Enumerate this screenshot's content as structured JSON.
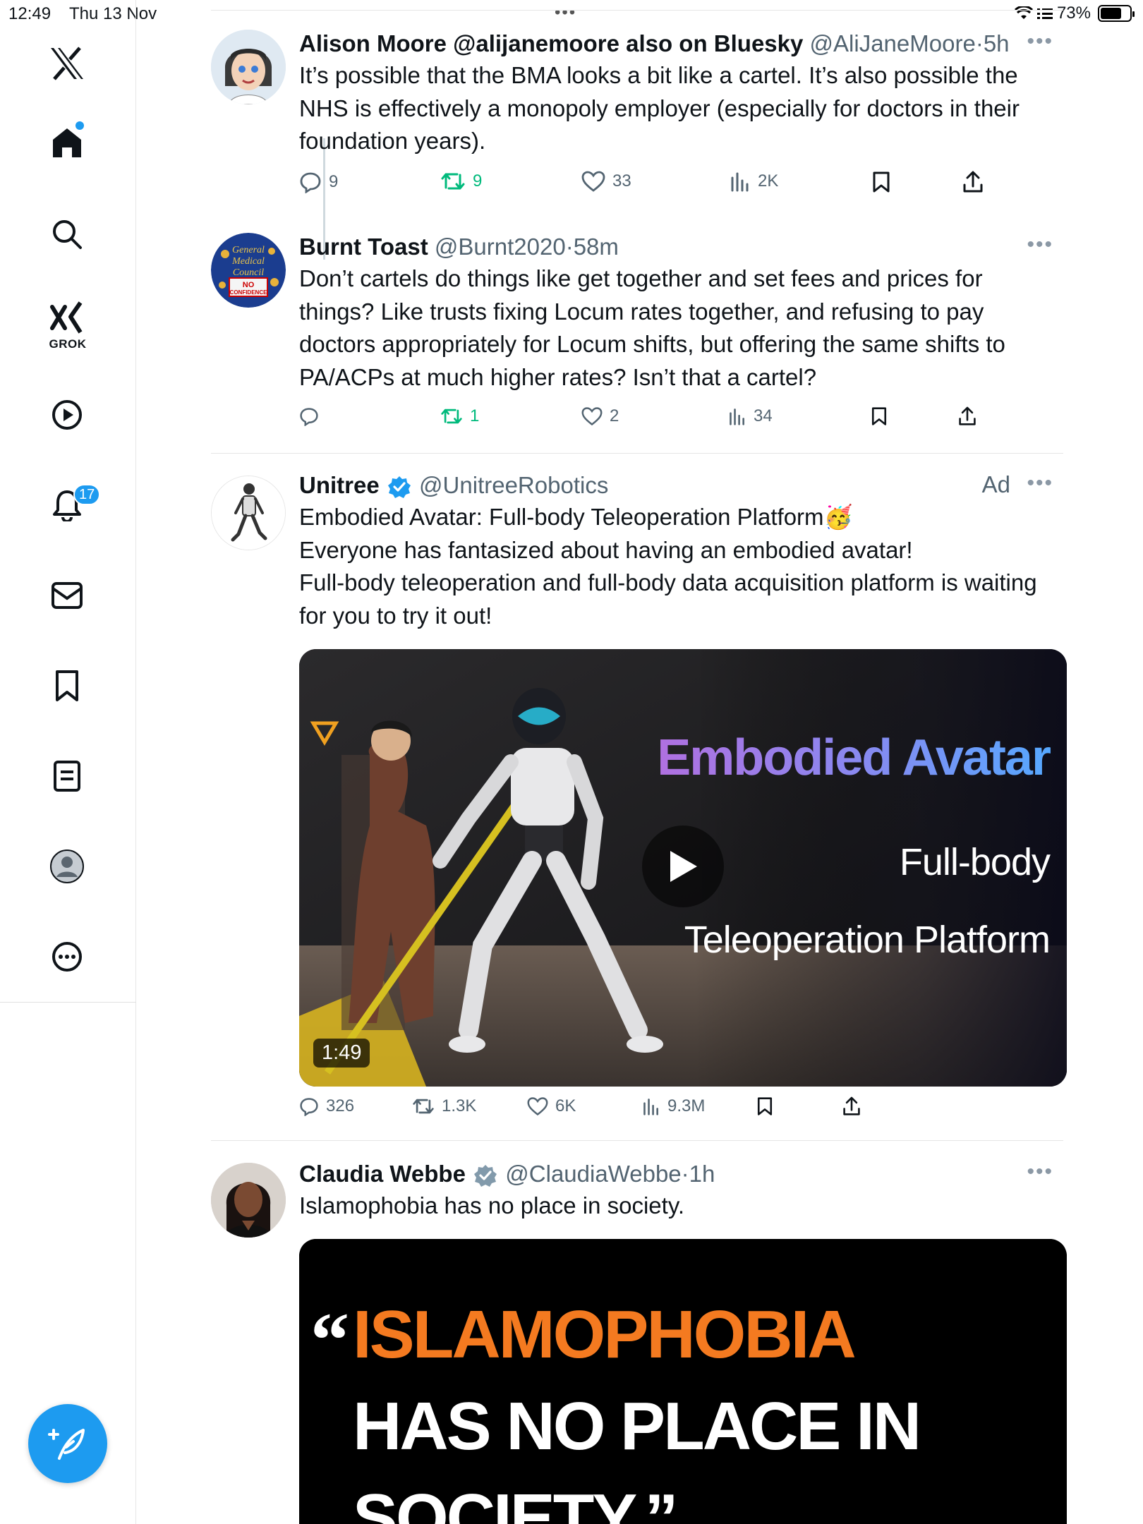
{
  "status": {
    "time": "12:49",
    "date": "Thu 13 Nov",
    "battery": "73%",
    "battery_level": 0.73,
    "dots": "•••"
  },
  "sidebar": {
    "grok_label": "GROK",
    "notifications_count": "17",
    "items": [
      "x-logo",
      "home",
      "search",
      "grok",
      "video",
      "notifications",
      "messages",
      "bookmarks",
      "lists",
      "profile",
      "more"
    ]
  },
  "tweets": [
    {
      "name": "Alison Moore @alijanemoore also on Bluesky",
      "handle": "@AliJaneMoore",
      "sep": "·",
      "time": "5h",
      "text": "It’s possible that the BMA looks a bit like a cartel. It’s also possible the NHS is effectively a monopoly employer (especially for doctors in their foundation years).",
      "replies": "9",
      "reposts": "9",
      "likes": "33",
      "views": "2K"
    },
    {
      "name": "Burnt Toast",
      "handle": "@Burnt2020",
      "sep": "·",
      "time": "58m",
      "text": "Don’t cartels do things like get together and set fees and prices for things? Like trusts fixing Locum rates together, and refusing to pay doctors appropriately for Locum shifts, but offering the same shifts to PA/ACPs at much higher rates? Isn’t that a cartel?",
      "replies": "",
      "reposts": "1",
      "likes": "2",
      "views": "34",
      "avatar_text": [
        "General",
        "Medical",
        "Council",
        "NO",
        "CONFIDENCE"
      ]
    },
    {
      "name": "Unitree",
      "handle": "@UnitreeRobotics",
      "ad": "Ad",
      "text_lines": [
        "Embodied Avatar: Full-body Teleoperation Platform🥳",
        "Everyone has fantasized about having an embodied avatar!",
        "Full-body teleoperation and full-body data acquisition platform is waiting for you to try it out!"
      ],
      "video": {
        "title": "Embodied Avatar",
        "line1": "Full-body",
        "line2": "Teleoperation Platform",
        "duration": "1:49"
      },
      "replies": "326",
      "reposts": "1.3K",
      "likes": "6K",
      "views": "9.3M"
    },
    {
      "name": "Claudia Webbe",
      "handle": "@ClaudiaWebbe",
      "sep": "·",
      "time": "1h",
      "text": "Islamophobia has no place in society.",
      "image": {
        "quote_mark": "“",
        "line1": "ISLAMOPHOBIA",
        "line2": "HAS NO PLACE IN",
        "line3": "SOCIETY.”"
      }
    }
  ],
  "colors": {
    "accent": "#1d9bf0",
    "repost_green": "#00ba7c",
    "muted": "#536471",
    "orange": "#f47a20"
  }
}
